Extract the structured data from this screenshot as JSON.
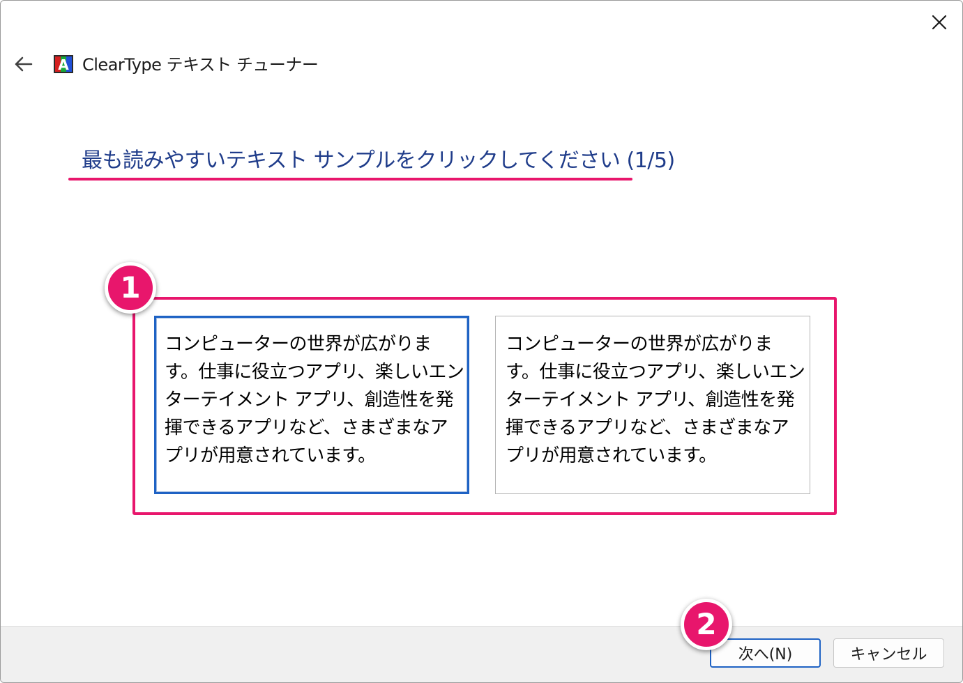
{
  "window": {
    "title": "ClearType テキスト チューナー",
    "app_icon_letter": "A"
  },
  "instruction": "最も読みやすいテキスト サンプルをクリックしてください (1/5)",
  "samples": [
    {
      "text": "コンピューターの世界が広がります。仕事に役立つアプリ、楽しいエンターテイメント アプリ、創造性を発揮できるアプリなど、さまざまなアプリが用意されています。",
      "selected": true
    },
    {
      "text": "コンピューターの世界が広がります。仕事に役立つアプリ、楽しいエンターテイメント アプリ、創造性を発揮できるアプリなど、さまざまなアプリが用意されています。",
      "selected": false
    }
  ],
  "callouts": [
    "1",
    "2"
  ],
  "buttons": {
    "next": "次へ(N)",
    "cancel": "キャンセル"
  },
  "colors": {
    "annotation": "#e8166c",
    "title_text": "#1f3c8a",
    "focus_border": "#1e62c4"
  },
  "icons": {
    "close": "close-icon",
    "back": "back-arrow-icon",
    "app": "cleartype-icon"
  }
}
